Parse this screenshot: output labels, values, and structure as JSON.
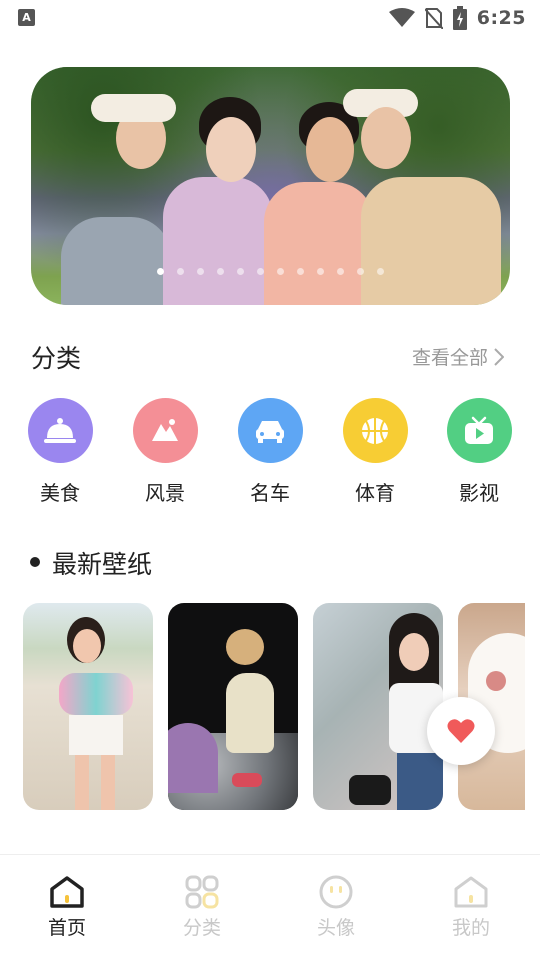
{
  "status_bar": {
    "left_icon": "A",
    "time": "6:25",
    "icons": [
      "wifi-icon",
      "no-sim-icon",
      "battery-charging-icon"
    ]
  },
  "banner": {
    "slide_count": 12,
    "active_index": 0
  },
  "category_section": {
    "title": "分类",
    "see_all": "查看全部"
  },
  "categories": [
    {
      "label": "美食",
      "icon": "food-cloche-icon",
      "color": "#9a86ef"
    },
    {
      "label": "风景",
      "icon": "mountain-icon",
      "color": "#f48f96"
    },
    {
      "label": "名车",
      "icon": "car-icon",
      "color": "#5ea6f4"
    },
    {
      "label": "体育",
      "icon": "basketball-icon",
      "color": "#f7cd34"
    },
    {
      "label": "影视",
      "icon": "tv-play-icon",
      "color": "#52cf83"
    }
  ],
  "latest_section": {
    "title": "最新壁纸"
  },
  "bottom_nav": [
    {
      "label": "首页",
      "icon": "home-icon",
      "active": true
    },
    {
      "label": "分类",
      "icon": "grid-icon",
      "active": false
    },
    {
      "label": "头像",
      "icon": "face-icon",
      "active": false
    },
    {
      "label": "我的",
      "icon": "profile-home-icon",
      "active": false
    }
  ],
  "colors": {
    "active_nav": "#222222",
    "inactive_nav": "#c8c8c8",
    "heart": "#f05a5a"
  }
}
